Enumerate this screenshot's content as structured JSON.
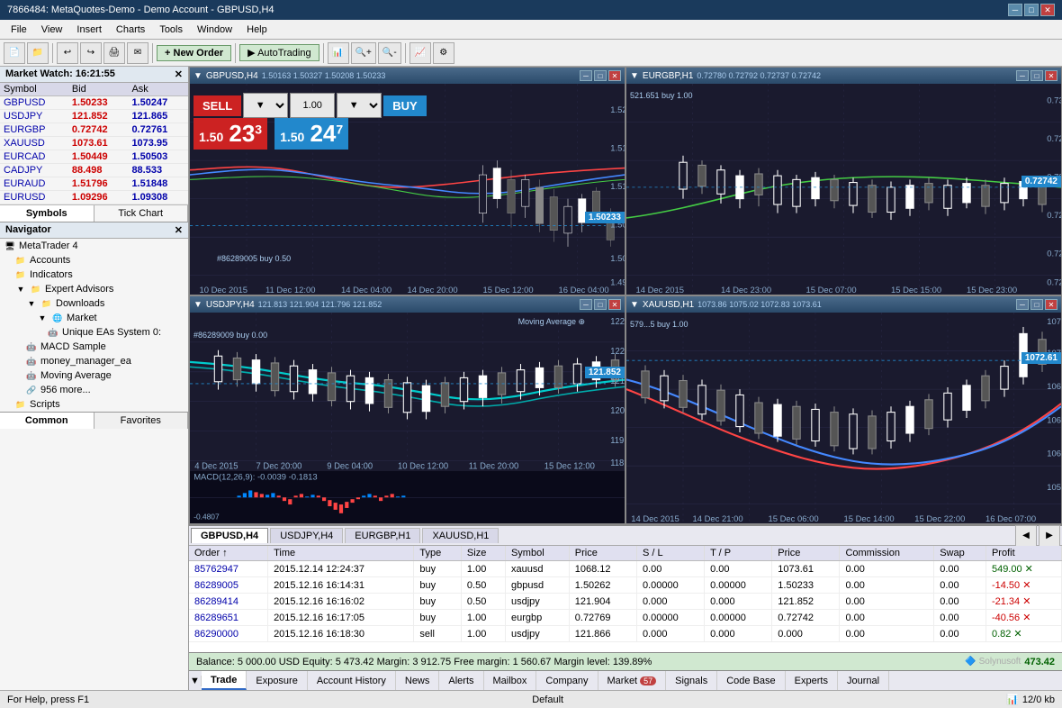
{
  "titlebar": {
    "title": "7866484: MetaQuotes-Demo - Demo Account - GBPUSD,H4",
    "min_btn": "─",
    "max_btn": "□",
    "close_btn": "✕"
  },
  "menubar": {
    "items": [
      "File",
      "View",
      "Insert",
      "Charts",
      "Tools",
      "Window",
      "Help"
    ]
  },
  "toolbar": {
    "new_order_label": "New Order",
    "autotrading_label": "AutoTrading"
  },
  "market_watch": {
    "header": "Market Watch: 16:21:55",
    "columns": [
      "Symbol",
      "Bid",
      "Ask"
    ],
    "rows": [
      {
        "symbol": "GBPUSD",
        "bid": "1.50233",
        "ask": "1.50247"
      },
      {
        "symbol": "USDJPY",
        "bid": "121.852",
        "ask": "121.865"
      },
      {
        "symbol": "EURGBP",
        "bid": "0.72742",
        "ask": "0.72761"
      },
      {
        "symbol": "XAUUSD",
        "bid": "1073.61",
        "ask": "1073.95"
      },
      {
        "symbol": "EURCAD",
        "bid": "1.50449",
        "ask": "1.50503"
      },
      {
        "symbol": "CADJPY",
        "bid": "88.498",
        "ask": "88.533"
      },
      {
        "symbol": "EURAUD",
        "bid": "1.51796",
        "ask": "1.51848"
      },
      {
        "symbol": "EURUSD",
        "bid": "1.09296",
        "ask": "1.09308"
      }
    ],
    "tab_symbols": "Symbols",
    "tab_tick": "Tick Chart"
  },
  "navigator": {
    "header": "Navigator",
    "items": [
      {
        "label": "MetaTrader 4",
        "level": 0,
        "type": "root"
      },
      {
        "label": "Accounts",
        "level": 1,
        "type": "folder"
      },
      {
        "label": "Indicators",
        "level": 1,
        "type": "folder"
      },
      {
        "label": "Expert Advisors",
        "level": 1,
        "type": "folder"
      },
      {
        "label": "Downloads",
        "level": 2,
        "type": "folder"
      },
      {
        "label": "Market",
        "level": 2,
        "type": "folder"
      },
      {
        "label": "Unique EAs System 0:",
        "level": 3,
        "type": "item"
      },
      {
        "label": "MACD Sample",
        "level": 2,
        "type": "item"
      },
      {
        "label": "money_manager_ea",
        "level": 2,
        "type": "item"
      },
      {
        "label": "Moving Average",
        "level": 2,
        "type": "item"
      },
      {
        "label": "956 more...",
        "level": 2,
        "type": "item"
      },
      {
        "label": "Scripts",
        "level": 1,
        "type": "folder"
      }
    ],
    "tab_common": "Common",
    "tab_favorites": "Favorites"
  },
  "charts": {
    "gbpusd": {
      "title": "GBPUSD,H4",
      "info_line": "GBPUSD,H4  1.50163  1.50327  1.50208  1.50233",
      "sell_label": "SELL",
      "buy_label": "BUY",
      "lot_value": "1.00",
      "sell_price_main": "23",
      "sell_price_sup": "3",
      "sell_prefix": "1.50",
      "buy_price_main": "24",
      "buy_price_sup": "7",
      "buy_prefix": "1.50",
      "current_price": "1.50233",
      "annotation": "#86289005 buy 0.50"
    },
    "eurgbp": {
      "title": "EURGBP,H1",
      "info_line": "EURGBP,H1  0.72780  0.72792  0.72737  0.72742",
      "current_price": "0.72742",
      "annotation": "521.651 buy 1.00"
    },
    "usdjpy": {
      "title": "USDJPY,H4",
      "info_line": "USDJPY,H4  121.813  121.904  121.796  121.852",
      "indicator": "Moving Average",
      "current_price": "121.852",
      "annotation": "#86289009 buy 0.00"
    },
    "xauusd": {
      "title": "XAUUSD,H1",
      "info_line": "XAUUSD,H1  1073.86  1075.02  1072.83  1073.61",
      "current_price": "1072.61",
      "annotation": "579...5 buy 1.00"
    }
  },
  "chart_tabs": {
    "items": [
      "GBPUSD,H4",
      "USDJPY,H4",
      "EURGBP,H1",
      "XAUUSD,H1"
    ],
    "active": 0
  },
  "orders_table": {
    "columns": [
      "Order ↑",
      "Time",
      "Type",
      "Size",
      "Symbol",
      "Price",
      "S / L",
      "T / P",
      "Price",
      "Commission",
      "Swap",
      "Profit"
    ],
    "rows": [
      {
        "order": "85762947",
        "time": "2015.12.14 12:24:37",
        "type": "buy",
        "size": "1.00",
        "symbol": "xauusd",
        "price_open": "1068.12",
        "sl": "0.00",
        "tp": "0.00",
        "price_cur": "1073.61",
        "commission": "0.00",
        "swap": "0.00",
        "profit": "549.00"
      },
      {
        "order": "86289005",
        "time": "2015.12.16 16:14:31",
        "type": "buy",
        "size": "0.50",
        "symbol": "gbpusd",
        "price_open": "1.50262",
        "sl": "0.00000",
        "tp": "0.00000",
        "price_cur": "1.50233",
        "commission": "0.00",
        "swap": "0.00",
        "profit": "-14.50"
      },
      {
        "order": "86289414",
        "time": "2015.12.16 16:16:02",
        "type": "buy",
        "size": "0.50",
        "symbol": "usdjpy",
        "price_open": "121.904",
        "sl": "0.000",
        "tp": "0.000",
        "price_cur": "121.852",
        "commission": "0.00",
        "swap": "0.00",
        "profit": "-21.34"
      },
      {
        "order": "86289651",
        "time": "2015.12.16 16:17:05",
        "type": "buy",
        "size": "1.00",
        "symbol": "eurgbp",
        "price_open": "0.72769",
        "sl": "0.00000",
        "tp": "0.00000",
        "price_cur": "0.72742",
        "commission": "0.00",
        "swap": "0.00",
        "profit": "-40.56"
      },
      {
        "order": "86290000",
        "time": "2015.12.16 16:18:30",
        "type": "sell",
        "size": "1.00",
        "symbol": "usdjpy",
        "price_open": "121.866",
        "sl": "0.000",
        "tp": "0.000",
        "price_cur": "0.000",
        "commission": "0.00",
        "swap": "0.00",
        "profit": "0.82"
      }
    ]
  },
  "status_bar": {
    "text": "Balance: 5 000.00 USD  Equity: 5 473.42  Margin: 3 912.75  Free margin: 1 560.67  Margin level: 139.89%",
    "equity": "473.42",
    "logo": "Solynusoft"
  },
  "bottom_nav": {
    "items": [
      {
        "label": "Trade",
        "active": true
      },
      {
        "label": "Exposure"
      },
      {
        "label": "Account History"
      },
      {
        "label": "News"
      },
      {
        "label": "Alerts"
      },
      {
        "label": "Mailbox"
      },
      {
        "label": "Company"
      },
      {
        "label": "Market",
        "badge": "57"
      },
      {
        "label": "Signals"
      },
      {
        "label": "Code Base"
      },
      {
        "label": "Experts"
      },
      {
        "label": "Journal"
      }
    ]
  },
  "very_bottom": {
    "left": "For Help, press F1",
    "center": "Default",
    "right": "12/0 kb"
  }
}
